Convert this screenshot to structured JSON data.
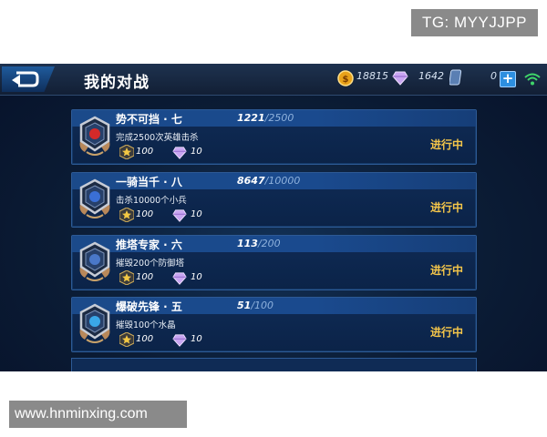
{
  "watermarks": {
    "top": "TG: MYYJJPP",
    "bottom": "www.hnminxing.com"
  },
  "header": {
    "title": "我的对战",
    "coins": "18815",
    "gems": "1642",
    "vouchers": "0",
    "plus_label": "+"
  },
  "tasks": [
    {
      "name": "势不可挡 · 七",
      "progress_current": "1221",
      "progress_total": "/2500",
      "desc": "完成2500次英雄击杀",
      "reward_coin": "100",
      "reward_gem": "10",
      "status": "进行中"
    },
    {
      "name": "一骑当千 · 八",
      "progress_current": "8647",
      "progress_total": "/10000",
      "desc": "击杀10000个小兵",
      "reward_coin": "100",
      "reward_gem": "10",
      "status": "进行中"
    },
    {
      "name": "推塔专家 · 六",
      "progress_current": "113",
      "progress_total": "/200",
      "desc": "摧毁200个防御塔",
      "reward_coin": "100",
      "reward_gem": "10",
      "status": "进行中"
    },
    {
      "name": "爆破先锋 · 五",
      "progress_current": "51",
      "progress_total": "/100",
      "desc": "摧毁100个水晶",
      "reward_coin": "100",
      "reward_gem": "10",
      "status": "进行中"
    }
  ],
  "colors": {
    "status": "#f4c64a",
    "accent": "#2d8fe0",
    "panel": "#0b2348"
  }
}
